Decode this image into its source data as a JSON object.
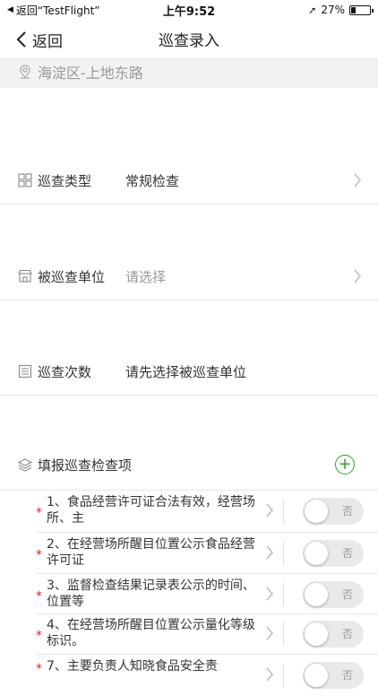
{
  "status_bar": {
    "back_app": "返回“TestFlight”",
    "time": "上午9:52",
    "battery": "27%",
    "battery_level": 0.27
  },
  "nav": {
    "back_label": "返回",
    "title": "巡查录入"
  },
  "location": {
    "text": "海淀区-上地东路"
  },
  "form": {
    "type": {
      "label": "巡查类型",
      "value": "常规检查"
    },
    "unit": {
      "label": "被巡查单位",
      "placeholder": "请选择"
    },
    "count": {
      "label": "巡查次数",
      "value": "请先选择被巡查单位"
    }
  },
  "checklist": {
    "title": "填报巡查检查项",
    "items": [
      {
        "text": "1、食品经营许可证合法有效，经营场所、主",
        "toggle": "否"
      },
      {
        "text": "2、在经营场所醒目位置公示食品经营许可证",
        "toggle": "否"
      },
      {
        "text": "3、监督检查结果记录表公示的时间、位置等",
        "toggle": "否"
      },
      {
        "text": "4、在经营场所醒目位置公示量化等级标识。",
        "toggle": "否"
      },
      {
        "text": "7、主要负责人知晓食品安全责",
        "toggle": "否"
      }
    ]
  }
}
